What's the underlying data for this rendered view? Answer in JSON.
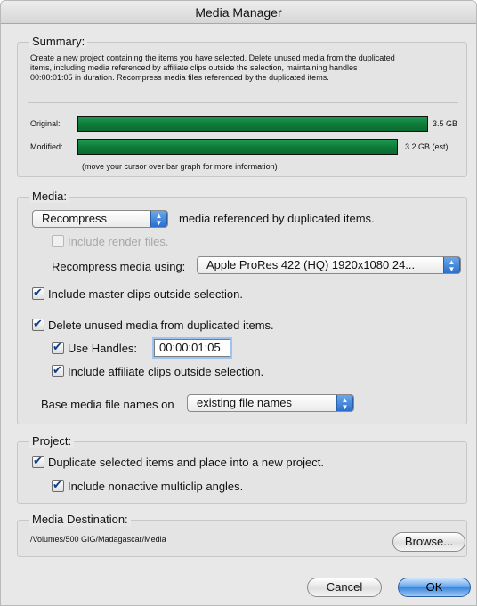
{
  "window": {
    "title": "Media Manager"
  },
  "summary": {
    "title": "Summary:",
    "description_lines": [
      "Create a new project containing the items you have selected. Delete unused media from the duplicated",
      "items, including media referenced by affiliate clips outside the selection, maintaining handles",
      "00:00:01:05 in duration. Recompress media files referenced by the duplicated items."
    ],
    "original_label": "Original:",
    "original_value": "3.5 GB",
    "original_fraction": 1.0,
    "modified_label": "Modified:",
    "modified_value": "3.2 GB (est)",
    "modified_fraction": 0.914,
    "hint": "(move your cursor over bar graph for more information)",
    "bar_color": "#10843f"
  },
  "media": {
    "title": "Media:",
    "action_popup": "Recompress",
    "action_suffix": "media referenced by duplicated items.",
    "include_render_files": "Include render files.",
    "recompress_label": "Recompress media using:",
    "recompress_popup": "Apple ProRes 422 (HQ) 1920x1080 24...",
    "include_master_clips": "Include master clips outside selection.",
    "delete_unused": "Delete unused media from duplicated items.",
    "use_handles": "Use Handles:",
    "handles_value": "00:00:01:05",
    "include_affiliate": "Include affiliate clips outside selection.",
    "base_names_label": "Base media file names on",
    "base_names_popup": "existing file names"
  },
  "project": {
    "title": "Project:",
    "duplicate_label": "Duplicate selected items and place into a new project.",
    "nonactive_label": "Include nonactive multiclip angles."
  },
  "destination": {
    "title": "Media Destination:",
    "path": "/Volumes/500 GIG/Madagascar/Media",
    "browse": "Browse..."
  },
  "footer": {
    "cancel": "Cancel",
    "ok": "OK"
  }
}
